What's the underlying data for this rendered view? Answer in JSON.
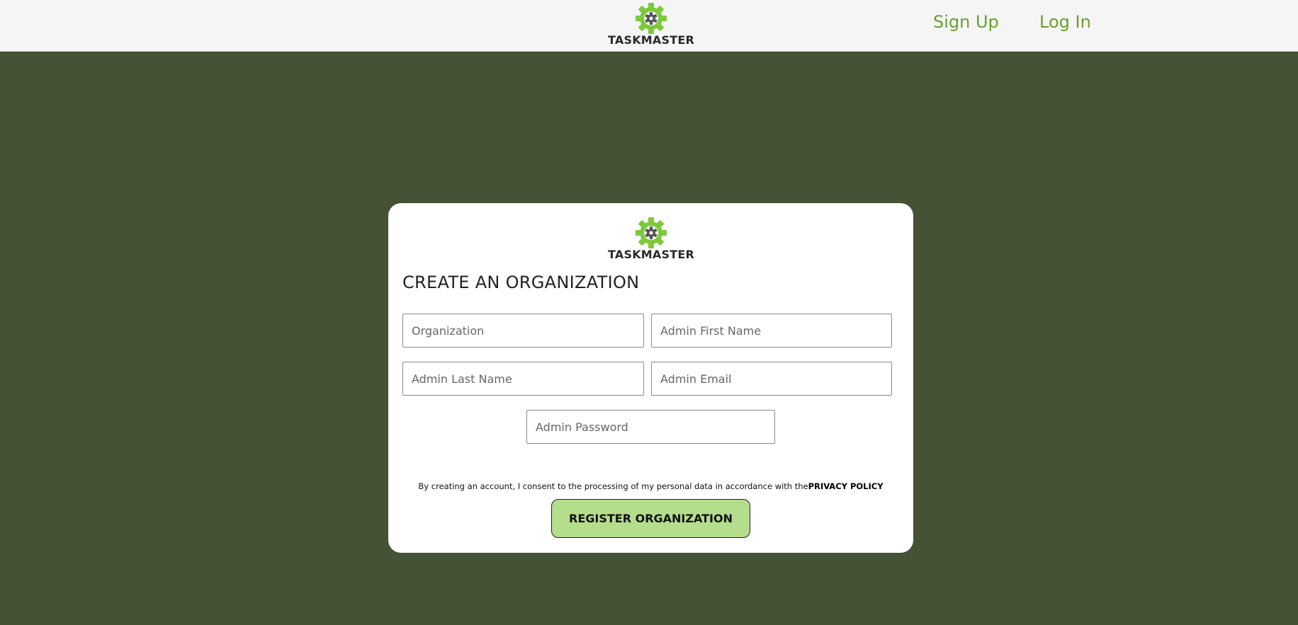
{
  "brand": {
    "name": "TASKMASTER",
    "gear_color": "#7cc93a",
    "inner_color": "#555555"
  },
  "nav": {
    "signup_label": "Sign Up",
    "login_label": "Log In",
    "link_color": "#6aa02c"
  },
  "form": {
    "title": "CREATE AN ORGANIZATION",
    "fields": {
      "organization": {
        "placeholder": "Organization",
        "value": ""
      },
      "first_name": {
        "placeholder": "Admin First Name",
        "value": ""
      },
      "last_name": {
        "placeholder": "Admin Last Name",
        "value": ""
      },
      "email": {
        "placeholder": "Admin Email",
        "value": ""
      },
      "password": {
        "placeholder": "Admin Password",
        "value": ""
      }
    },
    "consent_text": "By creating an account, I consent to the processing of my personal data in accordance with the",
    "privacy_link": "PRIVACY POLICY",
    "submit_label": "REGISTER ORGANIZATION"
  },
  "colors": {
    "background": "#455236",
    "topbar": "#f5f5f5",
    "button": "#b4dd8c"
  }
}
